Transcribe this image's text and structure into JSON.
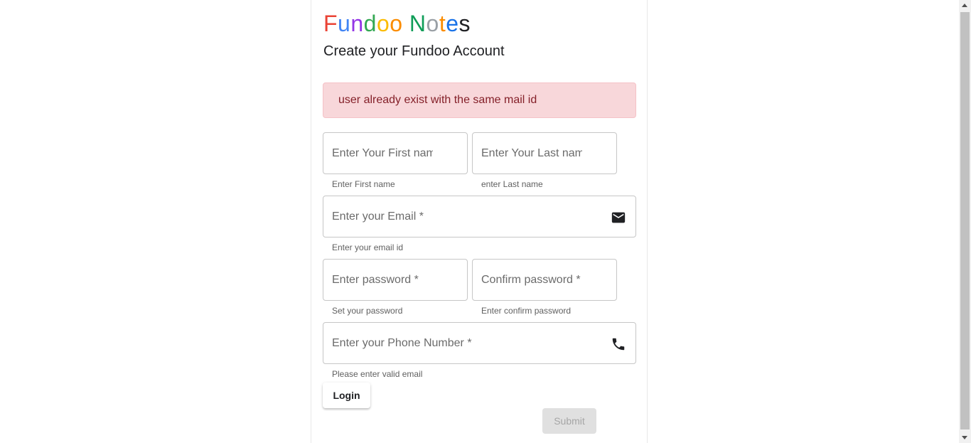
{
  "brand": {
    "letters": [
      "F",
      "u",
      "n",
      "d",
      "o",
      "o",
      " ",
      "N",
      "o",
      "t",
      "e",
      "s"
    ],
    "colors": [
      "#ea4335",
      "#4285f4",
      "#9334e6",
      "#34a853",
      "#fbbc04",
      "#fb8c00",
      "#000000",
      "#0f9d58",
      "#9aa0a6",
      "#fb8c00",
      "#1a73e8",
      "#202124"
    ]
  },
  "subtitle": "Create your Fundoo Account",
  "alert": {
    "message": "user already exist with the same mail id",
    "background": "#f8d7da",
    "text_color": "#842029"
  },
  "form": {
    "first_name": {
      "placeholder": "Enter Your First name *",
      "value": "",
      "hint": "Enter First name"
    },
    "last_name": {
      "placeholder": "Enter Your Last name *",
      "value": "",
      "hint": "enter Last name"
    },
    "email": {
      "placeholder": "Enter your Email *",
      "value": "",
      "hint": "Enter your email id",
      "icon": "mail-icon"
    },
    "password": {
      "placeholder": "Enter password *",
      "value": "",
      "hint": "Set your password"
    },
    "confirm_password": {
      "placeholder": "Confirm password *",
      "value": "",
      "hint": "Enter confirm password"
    },
    "phone": {
      "placeholder": "Enter your Phone Number *",
      "value": "",
      "hint": "Please enter valid email",
      "icon": "phone-icon"
    }
  },
  "buttons": {
    "login_label": "Login",
    "submit_label": "Submit"
  }
}
